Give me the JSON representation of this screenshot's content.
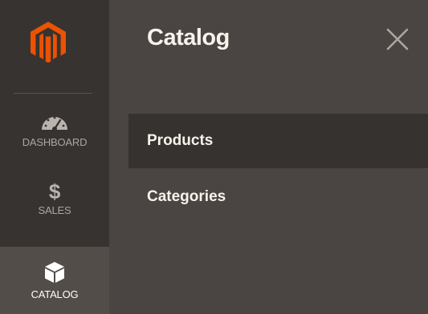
{
  "sidebar": {
    "logo_icon": "magento-logo-icon",
    "items": [
      {
        "id": "dashboard",
        "label": "DASHBOARD",
        "icon": "dashboard-gauge-icon"
      },
      {
        "id": "sales",
        "label": "SALES",
        "icon": "dollar-icon",
        "glyph": "$"
      },
      {
        "id": "catalog",
        "label": "CATALOG",
        "icon": "catalog-box-icon",
        "active": true
      }
    ]
  },
  "panel": {
    "title": "Catalog",
    "close_icon": "close-icon",
    "items": [
      {
        "label": "Products",
        "highlighted": true
      },
      {
        "label": "Categories",
        "highlighted": false
      }
    ]
  },
  "colors": {
    "sidebar_bg": "#373330",
    "sidebar_active_bg": "#524d49",
    "panel_bg": "#4a4542",
    "panel_item_hover_bg": "#363230",
    "logo_orange": "#eb5202",
    "text_light": "#f7f3eb",
    "text_muted": "#aaa6a0"
  }
}
